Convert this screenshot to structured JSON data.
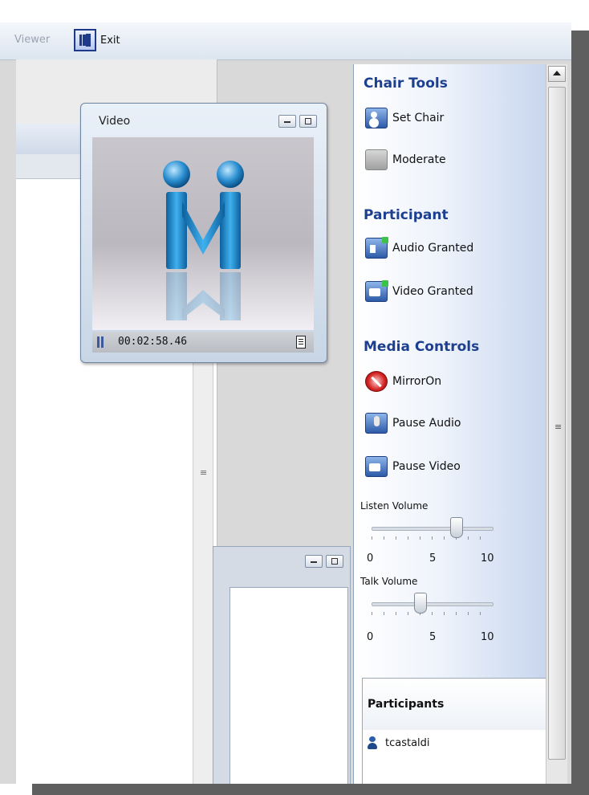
{
  "toolbar": {
    "viewer_label": "Viewer",
    "exit_label": "Exit"
  },
  "video_window": {
    "title": "Video",
    "timer": "00:02:58.46"
  },
  "chair_tools": {
    "title": "Chair Tools",
    "items": [
      {
        "label": "Set Chair",
        "icon": "set-chair-icon"
      },
      {
        "label": "Moderate",
        "icon": "moderate-icon"
      }
    ]
  },
  "participant": {
    "title": "Participant",
    "items": [
      {
        "label": "Audio Granted",
        "icon": "audio-granted-icon"
      },
      {
        "label": "Video Granted",
        "icon": "video-granted-icon"
      }
    ]
  },
  "media_controls": {
    "title": "Media Controls",
    "items": [
      {
        "label": "MirrorOn",
        "icon": "mirror-on-icon"
      },
      {
        "label": "Pause Audio",
        "icon": "pause-audio-icon"
      },
      {
        "label": "Pause Video",
        "icon": "pause-video-icon"
      }
    ]
  },
  "listen_volume": {
    "label": "Listen Volume",
    "value": 7,
    "min": 0,
    "max": 10,
    "scale": [
      "0",
      "5",
      "10"
    ]
  },
  "talk_volume": {
    "label": "Talk Volume",
    "value": 4,
    "min": 0,
    "max": 10,
    "scale": [
      "0",
      "5",
      "10"
    ]
  },
  "participants_list": {
    "title": "Participants",
    "items": [
      {
        "name": "tcastaldi"
      }
    ]
  },
  "colors": {
    "accent": "#1d3f8f",
    "toolbar_bg": "#dce5f0",
    "panel_bg": "#eef3fb"
  }
}
